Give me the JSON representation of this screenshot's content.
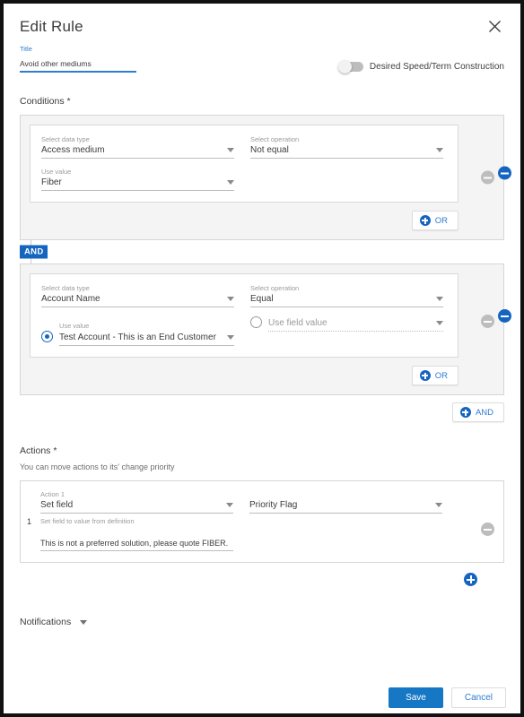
{
  "dialog": {
    "title": "Edit Rule",
    "close_icon": "close-icon"
  },
  "title_field": {
    "label": "Title",
    "value": "Avoid other mediums",
    "placeholder": "Title"
  },
  "toggle": {
    "label": "Desired Speed/Term Construction",
    "state": "off"
  },
  "conditions": {
    "heading": "Conditions *",
    "separator_label": "AND",
    "add_and_label": "AND",
    "groups": [
      {
        "add_or_label": "OR",
        "rows": [
          {
            "data_type": {
              "label": "Select data type",
              "value": "Access medium"
            },
            "operation": {
              "label": "Select operation",
              "value": "Not equal"
            },
            "use_value": {
              "label": "Use value",
              "value": "Fiber"
            },
            "has_radio": false
          }
        ]
      },
      {
        "add_or_label": "OR",
        "rows": [
          {
            "data_type": {
              "label": "Select data type",
              "value": "Account Name"
            },
            "operation": {
              "label": "Select operation",
              "value": "Equal"
            },
            "use_value": {
              "label": "Use value",
              "value": "Test Account - This is an End Customer"
            },
            "use_field_value": {
              "label": "Use field value",
              "value": "Use field value"
            },
            "has_radio": true,
            "selected_radio": "use_value"
          }
        ]
      }
    ]
  },
  "actions": {
    "heading": "Actions *",
    "subtext": "You can move actions to its' change priority",
    "items": [
      {
        "index": "1",
        "label": "Action 1",
        "type_value": "Set field",
        "target_value": "Priority Flag",
        "helper": "Set field to value from definition",
        "text_value": "This is not a preferred solution, please quote FIBER."
      }
    ]
  },
  "notifications": {
    "label": "Notifications"
  },
  "footer": {
    "save_label": "Save",
    "cancel_label": "Cancel"
  },
  "colors": {
    "accent": "#1565c0",
    "primary_button": "#1677c4",
    "link": "#2f7dd1",
    "group_bg": "#f4f4f4"
  }
}
